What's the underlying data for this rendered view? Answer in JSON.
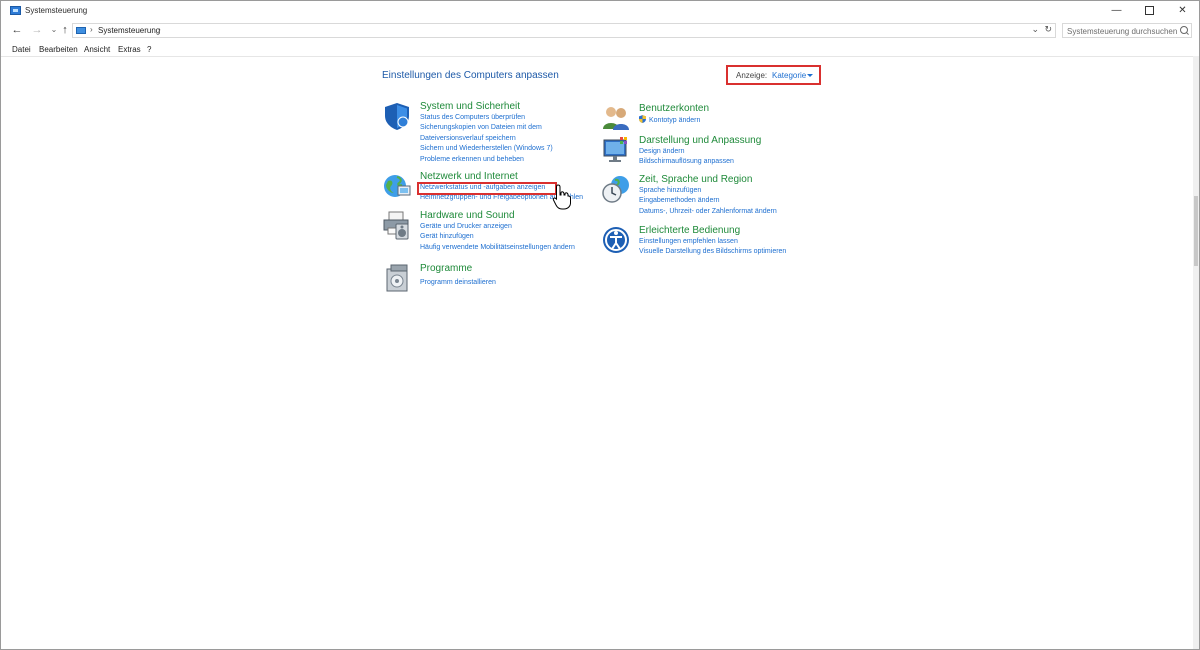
{
  "window": {
    "title": "Systemsteuerung",
    "controls": {
      "minimize": "—",
      "maximize": "",
      "close": "✕"
    }
  },
  "addressbar": {
    "back": "←",
    "forward": "→",
    "history": "⌄",
    "up": "↑",
    "crumb_sep": "›",
    "crumb": "Systemsteuerung",
    "dropdown": "⌄",
    "refresh": "↻",
    "search_placeholder": "Systemsteuerung durchsuchen"
  },
  "menubar": [
    "Datei",
    "Bearbeiten",
    "Ansicht",
    "Extras",
    "?"
  ],
  "content": {
    "title": "Einstellungen des Computers anpassen",
    "view_label": "Anzeige:",
    "view_value": "Kategorie"
  },
  "categories_left": [
    {
      "icon": "shield-icon",
      "title": "System und Sicherheit",
      "links": [
        "Status des Computers überprüfen",
        "Sicherungskopien von Dateien mit dem",
        "Dateiversionsverlauf speichern",
        "Sichern und Wiederherstellen (Windows 7)",
        "Probleme erkennen und beheben"
      ]
    },
    {
      "icon": "network-globe-icon",
      "title": "Netzwerk und Internet",
      "links": [
        "Netzwerkstatus und -aufgaben anzeigen",
        "Heimnetzgruppen- und Freigabeoptionen auswählen"
      ]
    },
    {
      "icon": "printer-speaker-icon",
      "title": "Hardware und Sound",
      "links": [
        "Geräte und Drucker anzeigen",
        "Gerät hinzufügen",
        "Häufig verwendete Mobilitätseinstellungen ändern"
      ]
    },
    {
      "icon": "programs-icon",
      "title": "Programme",
      "links": [
        "Programm deinstallieren"
      ]
    }
  ],
  "categories_right": [
    {
      "icon": "users-icon",
      "title": "Benutzerkonten",
      "links": [
        "Kontotyp ändern"
      ]
    },
    {
      "icon": "appearance-icon",
      "title": "Darstellung und Anpassung",
      "links": [
        "Design ändern",
        "Bildschirmauflösung anpassen"
      ]
    },
    {
      "icon": "clock-globe-icon",
      "title": "Zeit, Sprache und Region",
      "links": [
        "Sprache hinzufügen",
        "Eingabemethoden ändern",
        "Datums-, Uhrzeit- oder Zahlenformat ändern"
      ]
    },
    {
      "icon": "ease-of-access-icon",
      "title": "Erleichterte Bedienung",
      "links": [
        "Einstellungen empfehlen lassen",
        "Visuelle Darstellung des Bildschirms optimieren"
      ]
    }
  ],
  "colors": {
    "title_blue": "#1e5aa8",
    "category_green": "#1f8a3a",
    "link_blue": "#1e6fd0",
    "highlight_red": "#d9302f"
  }
}
